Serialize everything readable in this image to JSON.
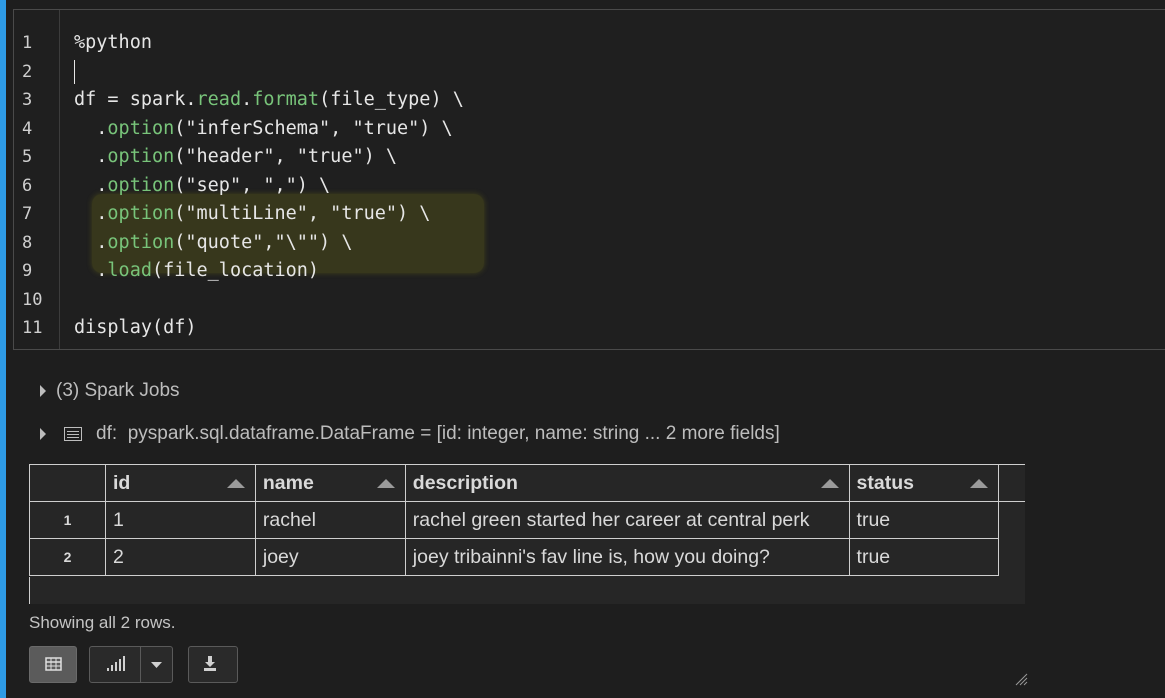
{
  "code": {
    "lines": [
      {
        "num": "1",
        "text": "%python"
      },
      {
        "num": "2",
        "text": ""
      },
      {
        "num": "3",
        "text": "df = spark.read.format(file_type) \\"
      },
      {
        "num": "4",
        "text": "  .option(\"inferSchema\", \"true\") \\"
      },
      {
        "num": "5",
        "text": "  .option(\"header\", \"true\") \\"
      },
      {
        "num": "6",
        "text": "  .option(\"sep\", \",\") \\"
      },
      {
        "num": "7",
        "text": "  .option(\"multiLine\", \"true\") \\"
      },
      {
        "num": "8",
        "text": "  .option(\"quote\",\"\\\"\") \\"
      },
      {
        "num": "9",
        "text": "  .load(file_location)"
      },
      {
        "num": "10",
        "text": ""
      },
      {
        "num": "11",
        "text": "display(df)"
      }
    ]
  },
  "output": {
    "spark_jobs_label": "(3) Spark Jobs",
    "df_label": "df:",
    "df_schema": "pyspark.sql.dataframe.DataFrame = [id: integer, name: string ... 2 more fields]"
  },
  "table": {
    "headers": [
      "id",
      "name",
      "description",
      "status"
    ],
    "rows": [
      {
        "index": "1",
        "cells": [
          "1",
          "rachel",
          "rachel green started her career at central perk",
          "true"
        ]
      },
      {
        "index": "2",
        "cells": [
          "2",
          "joey",
          "joey tribainni's fav line is, how you doing?",
          "true"
        ]
      }
    ]
  },
  "footer": {
    "showing_text": "Showing all 2 rows."
  },
  "icons": {
    "table_view": "table-icon",
    "chart_view": "bar-chart-icon",
    "dropdown": "chevron-down-icon",
    "download": "download-icon"
  },
  "colors": {
    "accent": "#2e9be6",
    "function": "#78c47a",
    "highlight": "#6b6b14"
  }
}
